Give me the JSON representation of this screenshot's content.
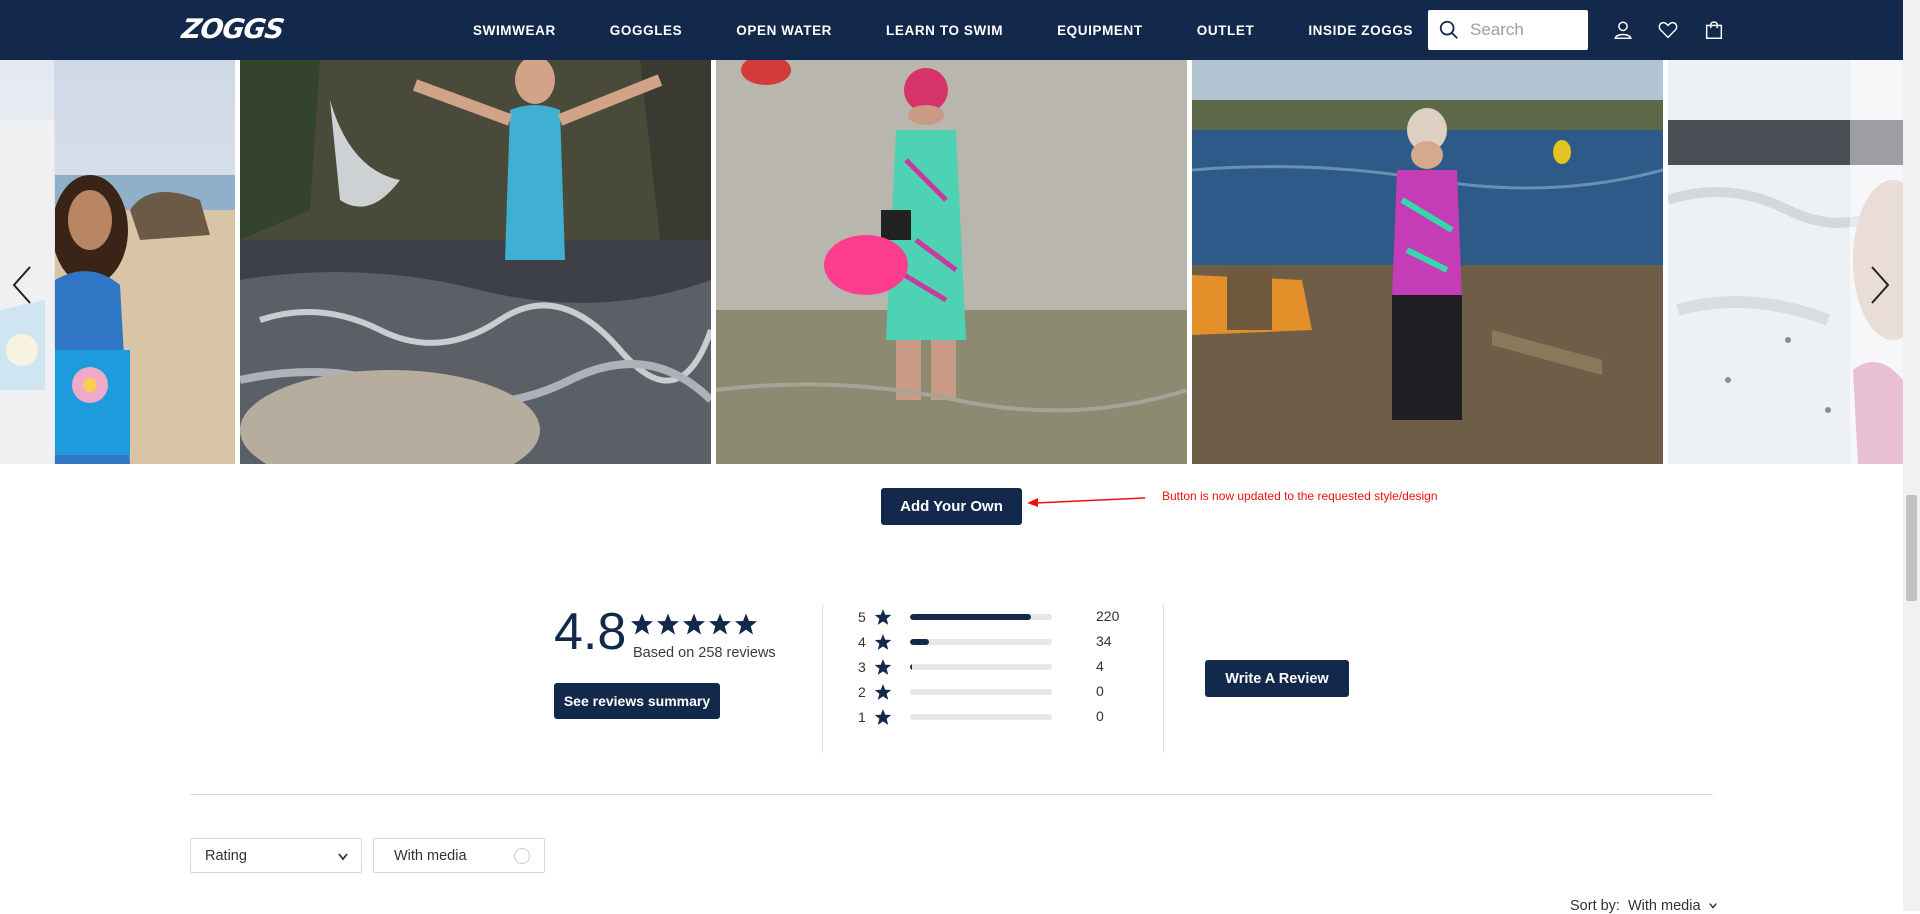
{
  "header": {
    "logo": "ZOGGS",
    "nav": [
      "SWIMWEAR",
      "GOGGLES",
      "OPEN WATER",
      "LEARN TO SWIM",
      "EQUIPMENT",
      "OUTLET",
      "INSIDE ZOGGS"
    ],
    "search_placeholder": "Search"
  },
  "gallery": {
    "add_button": "Add Your Own",
    "annotation": "Button is now updated to the requested style/design"
  },
  "reviews": {
    "average": "4.8",
    "based_on": "Based on 258 reviews",
    "summary_button": "See reviews summary",
    "write_button": "Write A Review",
    "distribution": [
      {
        "stars": "5",
        "count": "220",
        "fraction": 0.853
      },
      {
        "stars": "4",
        "count": "34",
        "fraction": 0.132
      },
      {
        "stars": "3",
        "count": "4",
        "fraction": 0.016
      },
      {
        "stars": "2",
        "count": "0",
        "fraction": 0
      },
      {
        "stars": "1",
        "count": "0",
        "fraction": 0
      }
    ]
  },
  "filters": {
    "rating_label": "Rating",
    "media_label": "With media",
    "sort_label": "Sort by:",
    "sort_value": "With media"
  },
  "colors": {
    "brand": "#13294b",
    "annotation": "#e11111"
  }
}
